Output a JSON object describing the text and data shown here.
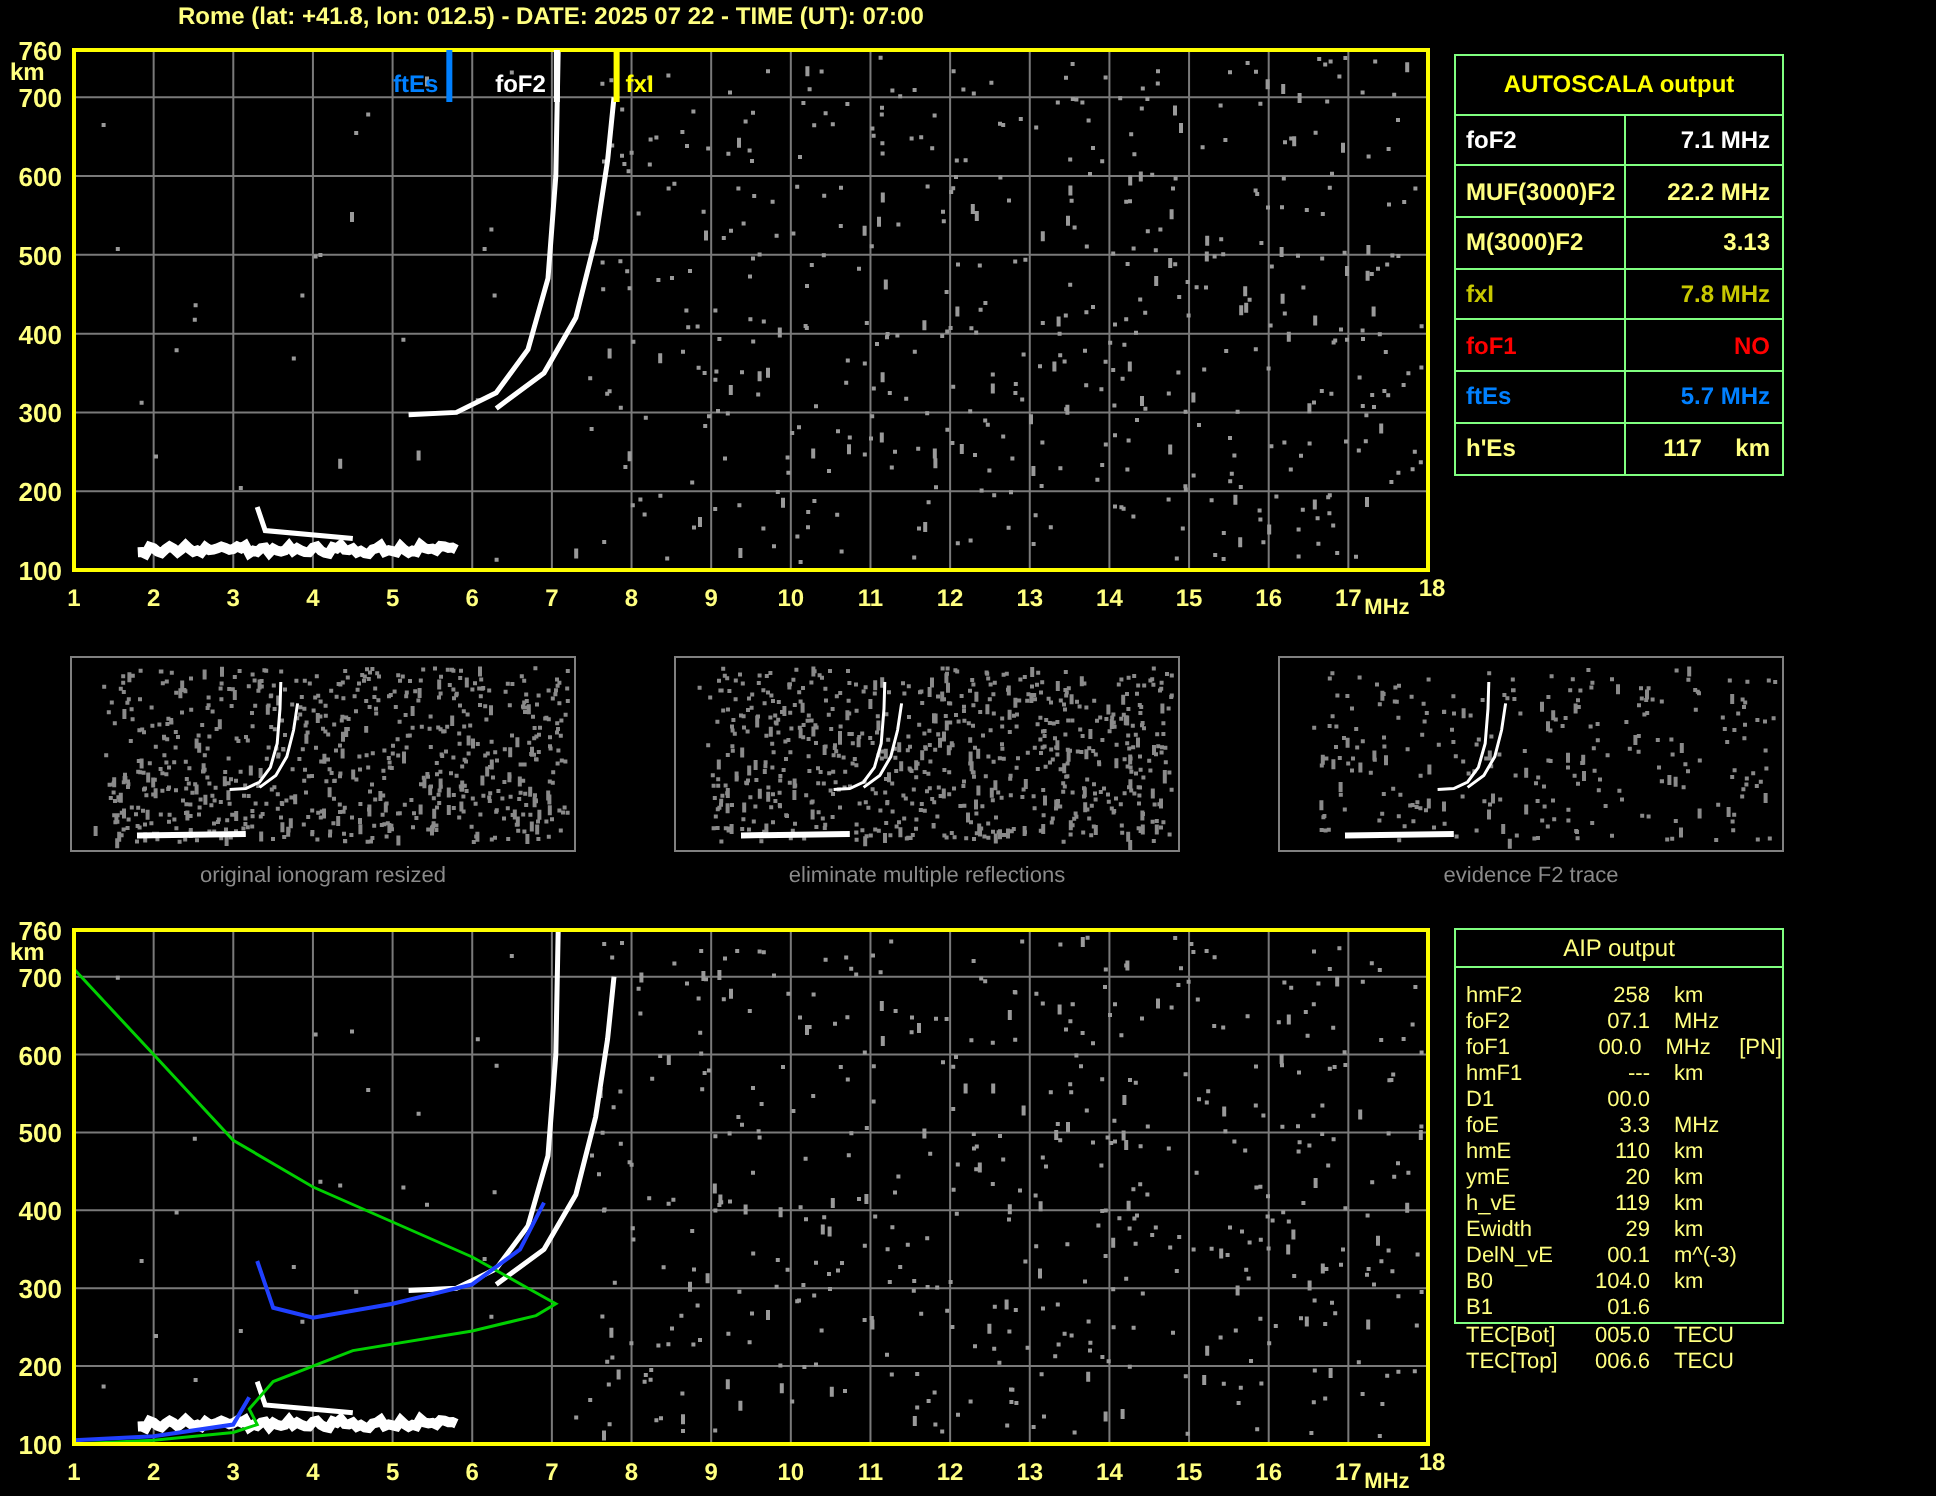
{
  "title": "Rome (lat: +41.8, lon: 012.5) - DATE: 2025 07 22 - TIME (UT): 07:00",
  "top_ionogram": {
    "y_unit": "km",
    "x_unit": "MHz",
    "y_ticks": [
      "760",
      "700",
      "600",
      "500",
      "400",
      "300",
      "200",
      "100"
    ],
    "x_ticks": [
      "1",
      "2",
      "3",
      "4",
      "5",
      "6",
      "7",
      "8",
      "9",
      "10",
      "11",
      "12",
      "13",
      "14",
      "15",
      "16",
      "17",
      "18"
    ],
    "markers": [
      {
        "label": "ftEs",
        "color": "#0080ff"
      },
      {
        "label": "foF2",
        "color": "#ffffff"
      },
      {
        "label": "fxI",
        "color": "#ffff00"
      }
    ]
  },
  "autoscala": {
    "title": "AUTOSCALA output",
    "rows": [
      {
        "label": "foF2",
        "value": "7.1 MHz",
        "color": "#ffffff"
      },
      {
        "label": "MUF(3000)F2",
        "value": "22.2 MHz",
        "color": "#ffff80"
      },
      {
        "label": "M(3000)F2",
        "value": "3.13",
        "color": "#ffff80"
      },
      {
        "label": "fxI",
        "value": "7.8 MHz",
        "color": "#c8c800"
      },
      {
        "label": "foF1",
        "value": "NO",
        "color": "#ff0000"
      },
      {
        "label": "ftEs",
        "value": "5.7 MHz",
        "color": "#0080ff"
      },
      {
        "label": "h'Es",
        "value": "117     km",
        "color": "#ffff80"
      }
    ]
  },
  "thumbnails": [
    {
      "caption": "original ionogram resized"
    },
    {
      "caption": "eliminate multiple reflections"
    },
    {
      "caption": "evidence F2 trace"
    }
  ],
  "bottom_ionogram": {
    "y_unit": "km",
    "x_unit": "MHz",
    "y_ticks": [
      "760",
      "700",
      "600",
      "500",
      "400",
      "300",
      "200",
      "100"
    ],
    "x_ticks": [
      "1",
      "2",
      "3",
      "4",
      "5",
      "6",
      "7",
      "8",
      "9",
      "10",
      "11",
      "12",
      "13",
      "14",
      "15",
      "16",
      "17",
      "18"
    ]
  },
  "aip": {
    "title": "AIP output",
    "rows": [
      {
        "name": "hmF2",
        "value": "258",
        "unit": "km"
      },
      {
        "name": "foF2",
        "value": "07.1",
        "unit": "MHz"
      },
      {
        "name": "foF1",
        "value": "00.0",
        "unit": "MHz",
        "note": "[PN]"
      },
      {
        "name": "hmF1",
        "value": "---",
        "unit": "km"
      },
      {
        "name": "D1",
        "value": "00.0"
      },
      {
        "name": "foE",
        "value": "3.3",
        "unit": "MHz"
      },
      {
        "name": "hmE",
        "value": "110",
        "unit": "km"
      },
      {
        "name": "ymE",
        "value": "20",
        "unit": "km"
      },
      {
        "name": "h_vE",
        "value": "119",
        "unit": "km"
      },
      {
        "name": "Ewidth",
        "value": "29",
        "unit": "km"
      },
      {
        "name": "DelN_vE",
        "value": "00.1",
        "unit": "m^(-3)"
      },
      {
        "name": "B0",
        "value": "104.0",
        "unit": "km"
      },
      {
        "name": "B1",
        "value": "01.6"
      },
      {
        "name": "TEC[Bot]",
        "value": "005.0",
        "unit": "TECU"
      },
      {
        "name": "TEC[Top]",
        "value": "006.6",
        "unit": "TECU"
      }
    ]
  }
}
